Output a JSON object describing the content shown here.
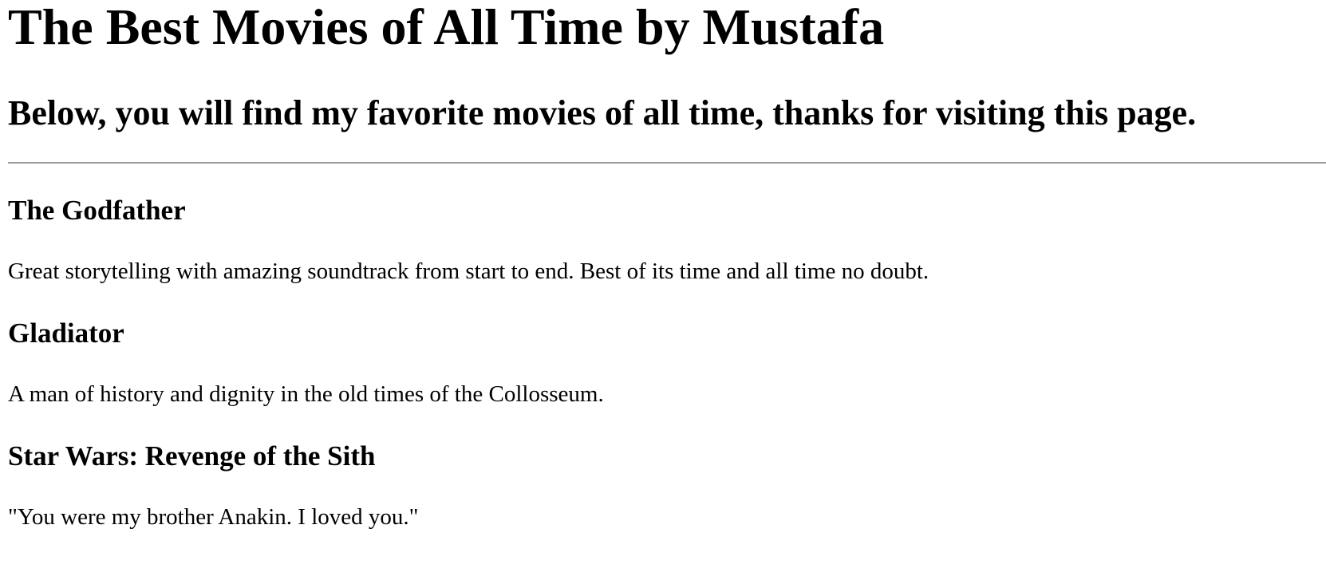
{
  "page": {
    "title": "The Best Movies of All Time by Mustafa",
    "subtitle": "Below, you will find my favorite movies of all time, thanks for visiting this page."
  },
  "movies": [
    {
      "title": "The Godfather",
      "description": "Great storytelling with amazing soundtrack from start to end. Best of its time and all time no doubt."
    },
    {
      "title": "Gladiator",
      "description": "A man of history and dignity in the old times of the Collosseum."
    },
    {
      "title": "Star Wars: Revenge of the Sith",
      "description": "\"You were my brother Anakin. I loved you.\""
    }
  ]
}
